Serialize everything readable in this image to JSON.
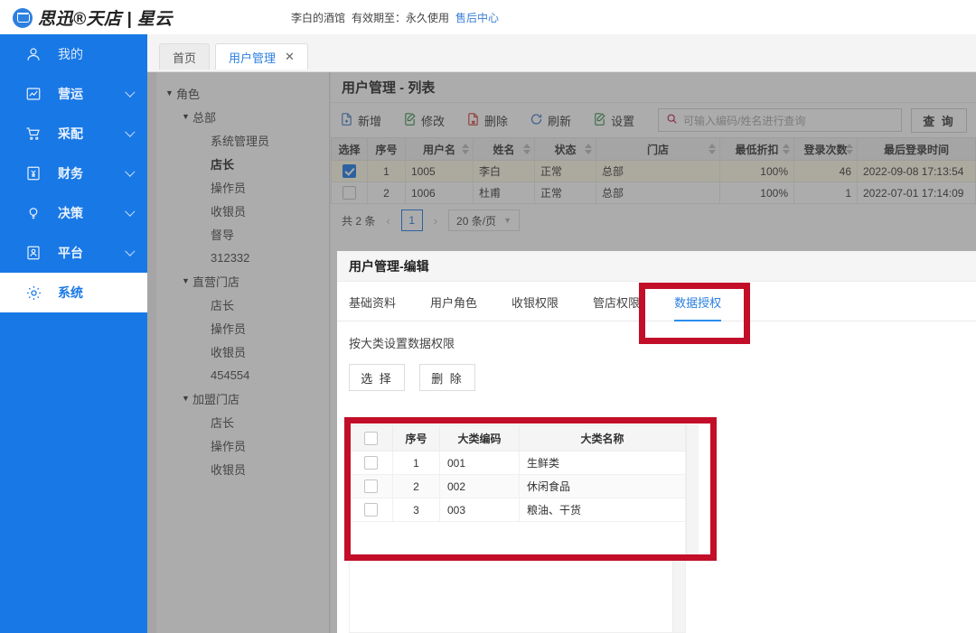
{
  "header": {
    "logo_text": "思迅®天店 | 星云",
    "logo_icon": "cloud-cart-icon",
    "account_name": "李白的酒馆",
    "validity_label": "有效期至：",
    "validity_value": "永久使用",
    "service_link": "售后中心"
  },
  "sidebar": {
    "items": [
      {
        "label": "我的",
        "icon": "user-icon",
        "arrow": false,
        "active": false
      },
      {
        "label": "营运",
        "icon": "chart-icon",
        "arrow": true,
        "active": false
      },
      {
        "label": "采配",
        "icon": "cart-icon",
        "arrow": true,
        "active": false
      },
      {
        "label": "财务",
        "icon": "finance-icon",
        "arrow": true,
        "active": false
      },
      {
        "label": "决策",
        "icon": "bulb-icon",
        "arrow": true,
        "active": false
      },
      {
        "label": "平台",
        "icon": "platform-icon",
        "arrow": true,
        "active": false
      },
      {
        "label": "系统",
        "icon": "gear-icon",
        "arrow": false,
        "active": true
      }
    ]
  },
  "page_tabs": [
    {
      "label": "首页",
      "selected": false,
      "closable": false
    },
    {
      "label": "用户管理",
      "selected": true,
      "closable": true,
      "close_icon": "close-icon"
    }
  ],
  "tree": {
    "nodes": [
      {
        "label": "角色",
        "level": 0,
        "caret": true,
        "bold": false
      },
      {
        "label": "总部",
        "level": 1,
        "caret": true,
        "bold": false
      },
      {
        "label": "系统管理员",
        "level": 2,
        "caret": false,
        "bold": false
      },
      {
        "label": "店长",
        "level": 2,
        "caret": false,
        "bold": true
      },
      {
        "label": "操作员",
        "level": 2,
        "caret": false,
        "bold": false
      },
      {
        "label": "收银员",
        "level": 2,
        "caret": false,
        "bold": false
      },
      {
        "label": "督导",
        "level": 2,
        "caret": false,
        "bold": false
      },
      {
        "label": "312332",
        "level": 2,
        "caret": false,
        "bold": false
      },
      {
        "label": "直营门店",
        "level": 1,
        "caret": true,
        "bold": false
      },
      {
        "label": "店长",
        "level": 2,
        "caret": false,
        "bold": false
      },
      {
        "label": "操作员",
        "level": 2,
        "caret": false,
        "bold": false
      },
      {
        "label": "收银员",
        "level": 2,
        "caret": false,
        "bold": false
      },
      {
        "label": "454554",
        "level": 2,
        "caret": false,
        "bold": false
      },
      {
        "label": "加盟门店",
        "level": 1,
        "caret": true,
        "bold": false
      },
      {
        "label": "店长",
        "level": 2,
        "caret": false,
        "bold": false
      },
      {
        "label": "操作员",
        "level": 2,
        "caret": false,
        "bold": false
      },
      {
        "label": "收银员",
        "level": 2,
        "caret": false,
        "bold": false
      }
    ]
  },
  "list_panel": {
    "title": "用户管理 - 列表",
    "toolbar": [
      {
        "label": "新增",
        "icon": "add-file-icon",
        "color": "#3a76c4"
      },
      {
        "label": "修改",
        "icon": "edit-file-icon",
        "color": "#2f8a3f"
      },
      {
        "label": "删除",
        "icon": "delete-file-icon",
        "color": "#d0342c"
      },
      {
        "label": "刷新",
        "icon": "refresh-icon",
        "color": "#3a76c4"
      },
      {
        "label": "设置",
        "icon": "settings-icon",
        "color": "#2f8a3f"
      }
    ],
    "search": {
      "icon": "search-icon",
      "placeholder": "可输入编码/姓名进行查询",
      "value": "",
      "button_label": "查 询"
    },
    "columns": [
      "选择",
      "序号",
      "用户名",
      "姓名",
      "状态",
      "门店",
      "最低折扣",
      "登录次数",
      "最后登录时间"
    ],
    "rows": [
      {
        "checked": true,
        "seq": "1",
        "username": "1005",
        "name": "李白",
        "status": "正常",
        "store": "总部",
        "discount": "100%",
        "logins": "46",
        "last_login": "2022-09-08 17:13:54"
      },
      {
        "checked": false,
        "seq": "2",
        "username": "1006",
        "name": "杜甫",
        "status": "正常",
        "store": "总部",
        "discount": "100%",
        "logins": "1",
        "last_login": "2022-07-01 17:14:09"
      }
    ],
    "pagination": {
      "total_text": "共 2 条",
      "prev_icon": "chevron-left-icon",
      "next_icon": "chevron-right-icon",
      "current_page": "1",
      "page_size": "20 条/页",
      "page_size_icon": "chevron-down-icon"
    }
  },
  "edit_panel": {
    "title": "用户管理-编辑",
    "tabs": [
      {
        "label": "基础资料",
        "selected": false
      },
      {
        "label": "用户角色",
        "selected": false
      },
      {
        "label": "收银权限",
        "selected": false
      },
      {
        "label": "管店权限",
        "selected": false
      },
      {
        "label": "数据授权",
        "selected": true
      }
    ],
    "section_label": "按大类设置数据权限",
    "buttons": [
      {
        "label": "选 择"
      },
      {
        "label": "删 除"
      }
    ],
    "category_table": {
      "columns": [
        "",
        "序号",
        "大类编码",
        "大类名称"
      ],
      "header_checkbox": false,
      "rows": [
        {
          "checked": false,
          "seq": "1",
          "code": "001",
          "name": "生鲜类"
        },
        {
          "checked": false,
          "seq": "2",
          "code": "002",
          "name": "休闲食品"
        },
        {
          "checked": false,
          "seq": "3",
          "code": "003",
          "name": "粮油、干货"
        }
      ]
    }
  },
  "annotations": [
    {
      "name": "data-auth-tab-highlight",
      "color": "#c20e28"
    },
    {
      "name": "category-table-highlight",
      "color": "#c20e28"
    }
  ]
}
